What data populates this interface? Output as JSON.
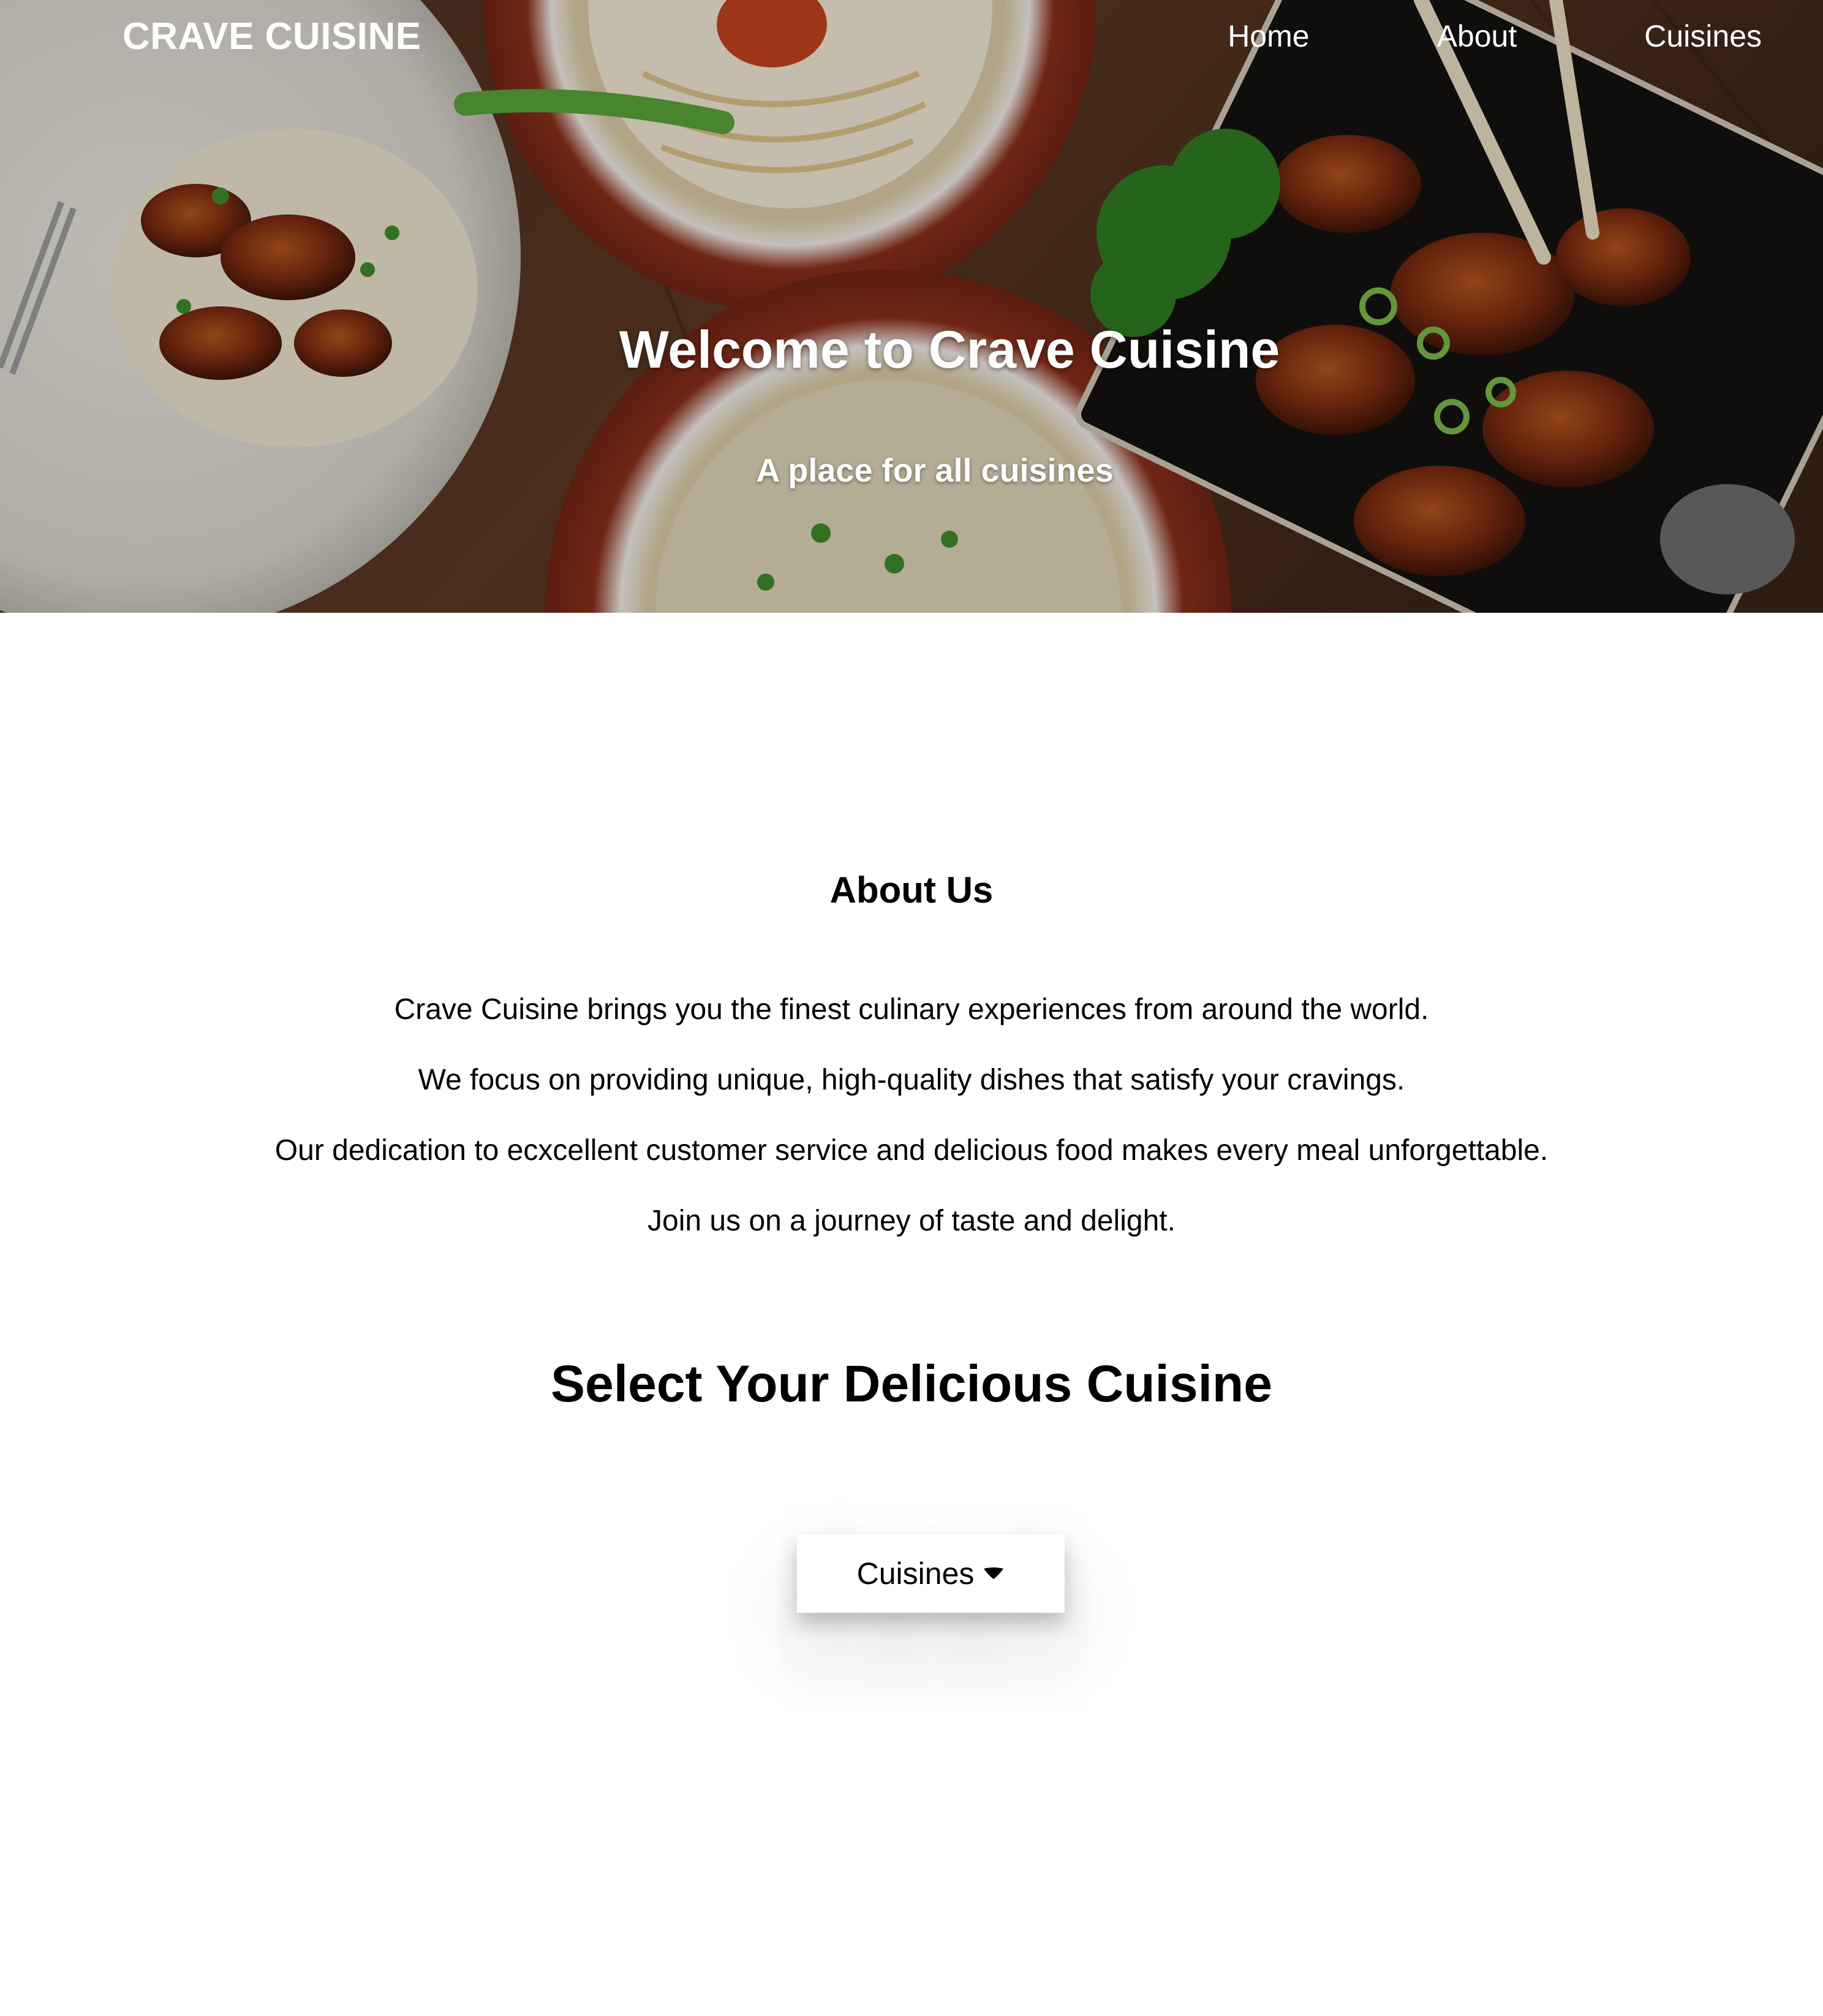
{
  "header": {
    "brand": "CRAVE CUISINE",
    "nav": [
      {
        "label": "Home"
      },
      {
        "label": "About"
      },
      {
        "label": "Cuisines"
      }
    ]
  },
  "hero": {
    "title": "Welcome to Crave Cuisine",
    "subtitle": "A place for all cuisines"
  },
  "about": {
    "title": "About Us",
    "paragraphs": [
      "Crave Cuisine brings you the finest culinary experiences from around the world.",
      "We focus on providing unique, high-quality dishes that satisfy your cravings.",
      "Our dedication to ecxcellent customer service and delicious food makes every meal unforgettable.",
      "Join us on a journey of taste and delight."
    ]
  },
  "cuisines": {
    "title": "Select Your Delicious Cuisine",
    "dropdown_label": "Cuisines",
    "dropdown_icon": "caret-down-icon"
  }
}
